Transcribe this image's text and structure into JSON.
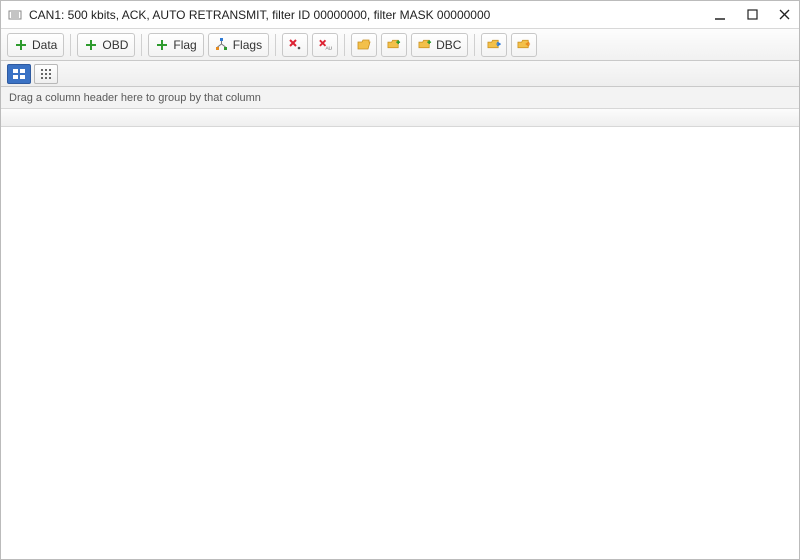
{
  "window": {
    "title": "CAN1: 500 kbits, ACK, AUTO RETRANSMIT, filter ID 00000000, filter MASK 00000000"
  },
  "toolbar": {
    "data_label": "Data",
    "obd_label": "OBD",
    "flag_label": "Flag",
    "flags_label": "Flags",
    "dbc_label": "DBC"
  },
  "grid": {
    "groupby_hint": "Drag a column header here to group by that column"
  }
}
